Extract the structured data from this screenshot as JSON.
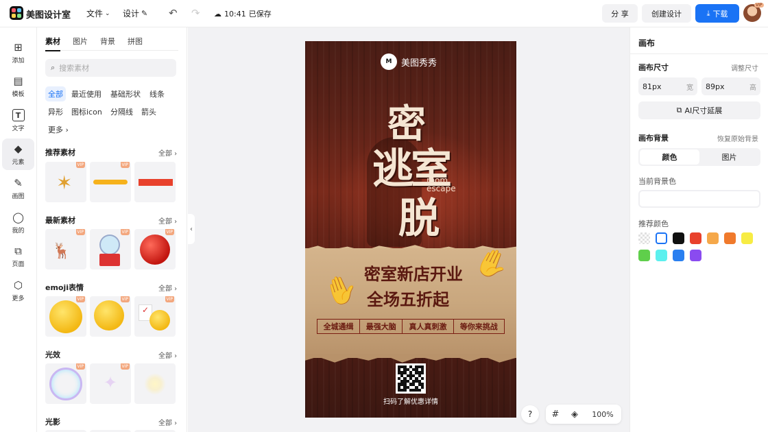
{
  "header": {
    "app_name": "美图设计室",
    "menu_file": "文件",
    "menu_design": "设计",
    "save_time": "10:41",
    "save_text": "已保存",
    "share_label": "分 享",
    "create_label": "创建设计",
    "download_label": "下载",
    "avatar_badge": "VIP"
  },
  "rail": {
    "items": [
      {
        "label": "添加",
        "icon": "plus-square-icon"
      },
      {
        "label": "模板",
        "icon": "template-icon"
      },
      {
        "label": "文字",
        "icon": "text-icon"
      },
      {
        "label": "元素",
        "icon": "shapes-icon"
      },
      {
        "label": "画图",
        "icon": "draw-icon"
      },
      {
        "label": "我的",
        "icon": "user-icon"
      },
      {
        "label": "页面",
        "icon": "page-add-icon"
      },
      {
        "label": "更多",
        "icon": "cube-icon"
      }
    ],
    "active_index": 3
  },
  "panel": {
    "tabs": [
      "素材",
      "图片",
      "背景",
      "拼图"
    ],
    "search_placeholder": "搜索素材",
    "chips": [
      "全部",
      "最近使用",
      "基础形状",
      "线条",
      "异形",
      "图标icon",
      "分隔线",
      "箭头",
      "更多"
    ],
    "sections": [
      {
        "title": "推荐素材",
        "all": "全部"
      },
      {
        "title": "最新素材",
        "all": "全部"
      },
      {
        "title": "emoji表情",
        "all": "全部"
      },
      {
        "title": "光效",
        "all": "全部"
      },
      {
        "title": "光影",
        "all": "全部"
      }
    ],
    "vip_badge": "VIP"
  },
  "poster": {
    "brand": "美图秀秀",
    "title_chars": [
      "密",
      "逃",
      "室",
      "脱"
    ],
    "title_en_1": "room",
    "title_en_2": "escape",
    "headline_1": "密室新店开业",
    "headline_2": "全场五折起",
    "tags": [
      "全城通缉",
      "最强大脑",
      "真人真刺激",
      "等你来挑战"
    ],
    "qr_caption": "扫码了解优惠详情"
  },
  "zoom": {
    "help": "?",
    "level": "100%"
  },
  "right": {
    "title": "画布",
    "size_label": "画布尺寸",
    "size_link": "调整尺寸",
    "width_value": "81px",
    "width_unit": "宽",
    "height_value": "89px",
    "height_unit": "高",
    "ai_extend": "AI尺寸延展",
    "bg_label": "画布背景",
    "bg_reset": "恢复原始背景",
    "seg_color": "颜色",
    "seg_image": "图片",
    "current_bg": "当前背景色",
    "recommended": "推荐颜色",
    "swatches": [
      "transparent",
      "#ffffff",
      "#111111",
      "#e8412c",
      "#f5a84a",
      "#f07a2c",
      "#f7ec44",
      "#5fcf4b",
      "#5cf0ee",
      "#2a7ff0",
      "#8a4bf0"
    ]
  }
}
